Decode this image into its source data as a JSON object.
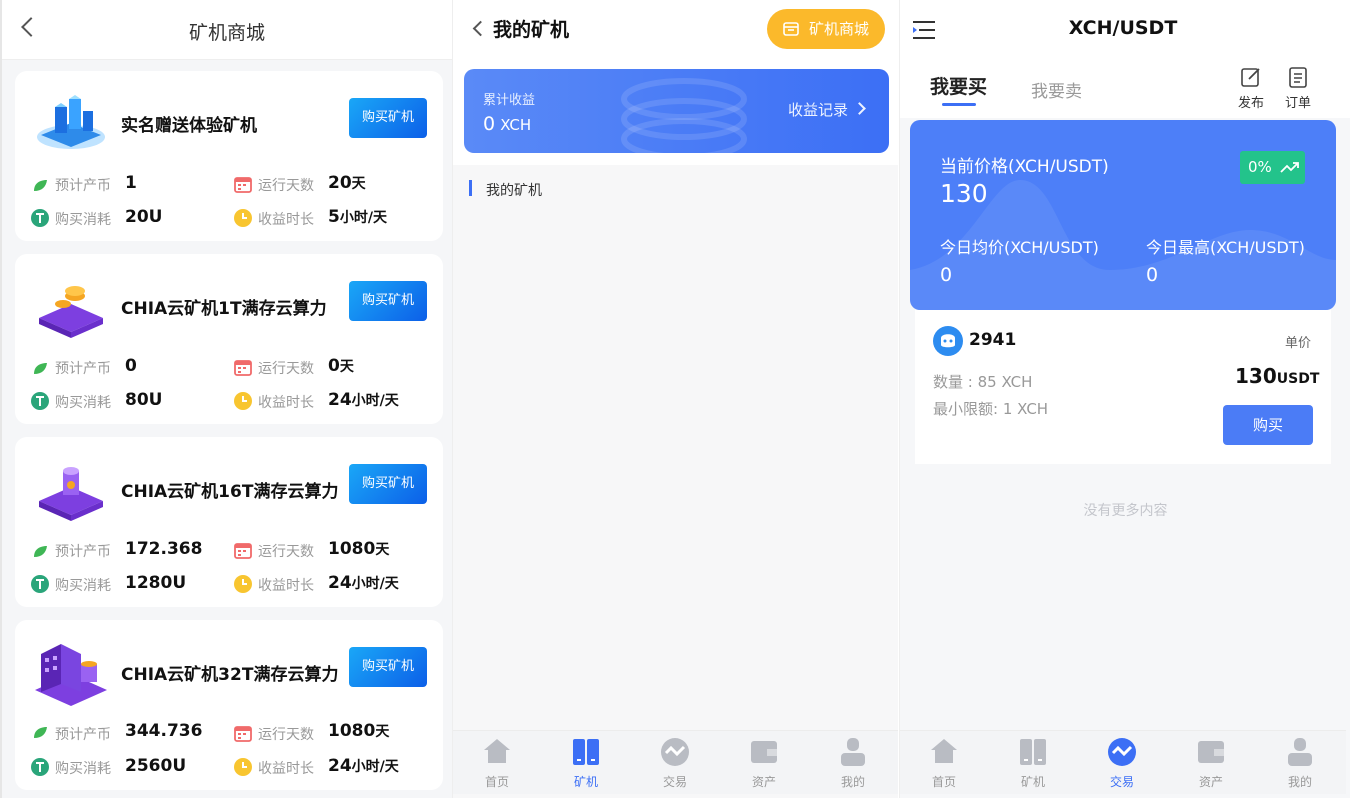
{
  "mall": {
    "title": "矿机商城",
    "stat_labels": {
      "output": "预计产币",
      "days": "运行天数",
      "cost": "购买消耗",
      "hours": "收益时长"
    },
    "buy_label": "购买矿机",
    "machines": [
      {
        "name": "实名赠送体验矿机",
        "output": "1",
        "days": "20",
        "days_unit": "天",
        "cost": "20U",
        "hours": "5",
        "hours_unit": "小时/天"
      },
      {
        "name": "CHIA云矿机1T满存云算力",
        "output": "0",
        "days": "0",
        "days_unit": "天",
        "cost": "80U",
        "hours": "24",
        "hours_unit": "小时/天"
      },
      {
        "name": "CHIA云矿机16T满存云算力",
        "output": "172.368",
        "days": "1080",
        "days_unit": "天",
        "cost": "1280U",
        "hours": "24",
        "hours_unit": "小时/天"
      },
      {
        "name": "CHIA云矿机32T满存云算力",
        "output": "344.736",
        "days": "1080",
        "days_unit": "天",
        "cost": "2560U",
        "hours": "24",
        "hours_unit": "小时/天"
      }
    ]
  },
  "my_miner": {
    "title": "我的矿机",
    "mall_button": "矿机商城",
    "earnings_label": "累计收益",
    "earnings_value": "0",
    "earnings_unit": "XCH",
    "records_link": "收益记录",
    "section_title": "我的矿机"
  },
  "tabbar": {
    "items": [
      {
        "label": "首页",
        "icon": "home-icon"
      },
      {
        "label": "矿机",
        "icon": "miner-icon"
      },
      {
        "label": "交易",
        "icon": "trade-icon"
      },
      {
        "label": "资产",
        "icon": "wallet-icon"
      },
      {
        "label": "我的",
        "icon": "user-icon"
      }
    ],
    "active_panel2": "矿机",
    "active_panel3": "交易"
  },
  "trade": {
    "title": "XCH/USDT",
    "tab_buy": "我要买",
    "tab_sell": "我要卖",
    "publish": "发布",
    "orders": "订单",
    "current_price_label": "当前价格(XCH/USDT)",
    "current_price": "130",
    "change": "0%",
    "avg_label": "今日均价(XCH/USDT)",
    "avg_value": "0",
    "high_label": "今日最高(XCH/USDT)",
    "high_value": "0",
    "order": {
      "user": "2941",
      "unit_price_label": "单价",
      "quantity": "数量 : 85 XCH",
      "min_limit": "最小限额: 1 XCH",
      "price": "130",
      "price_unit": "USDT",
      "buy_button": "购买"
    },
    "no_more": "没有更多内容"
  },
  "colors": {
    "accent": "#3c6ff5",
    "mall_button": "#fbb92b",
    "change_badge": "#23c38b"
  }
}
